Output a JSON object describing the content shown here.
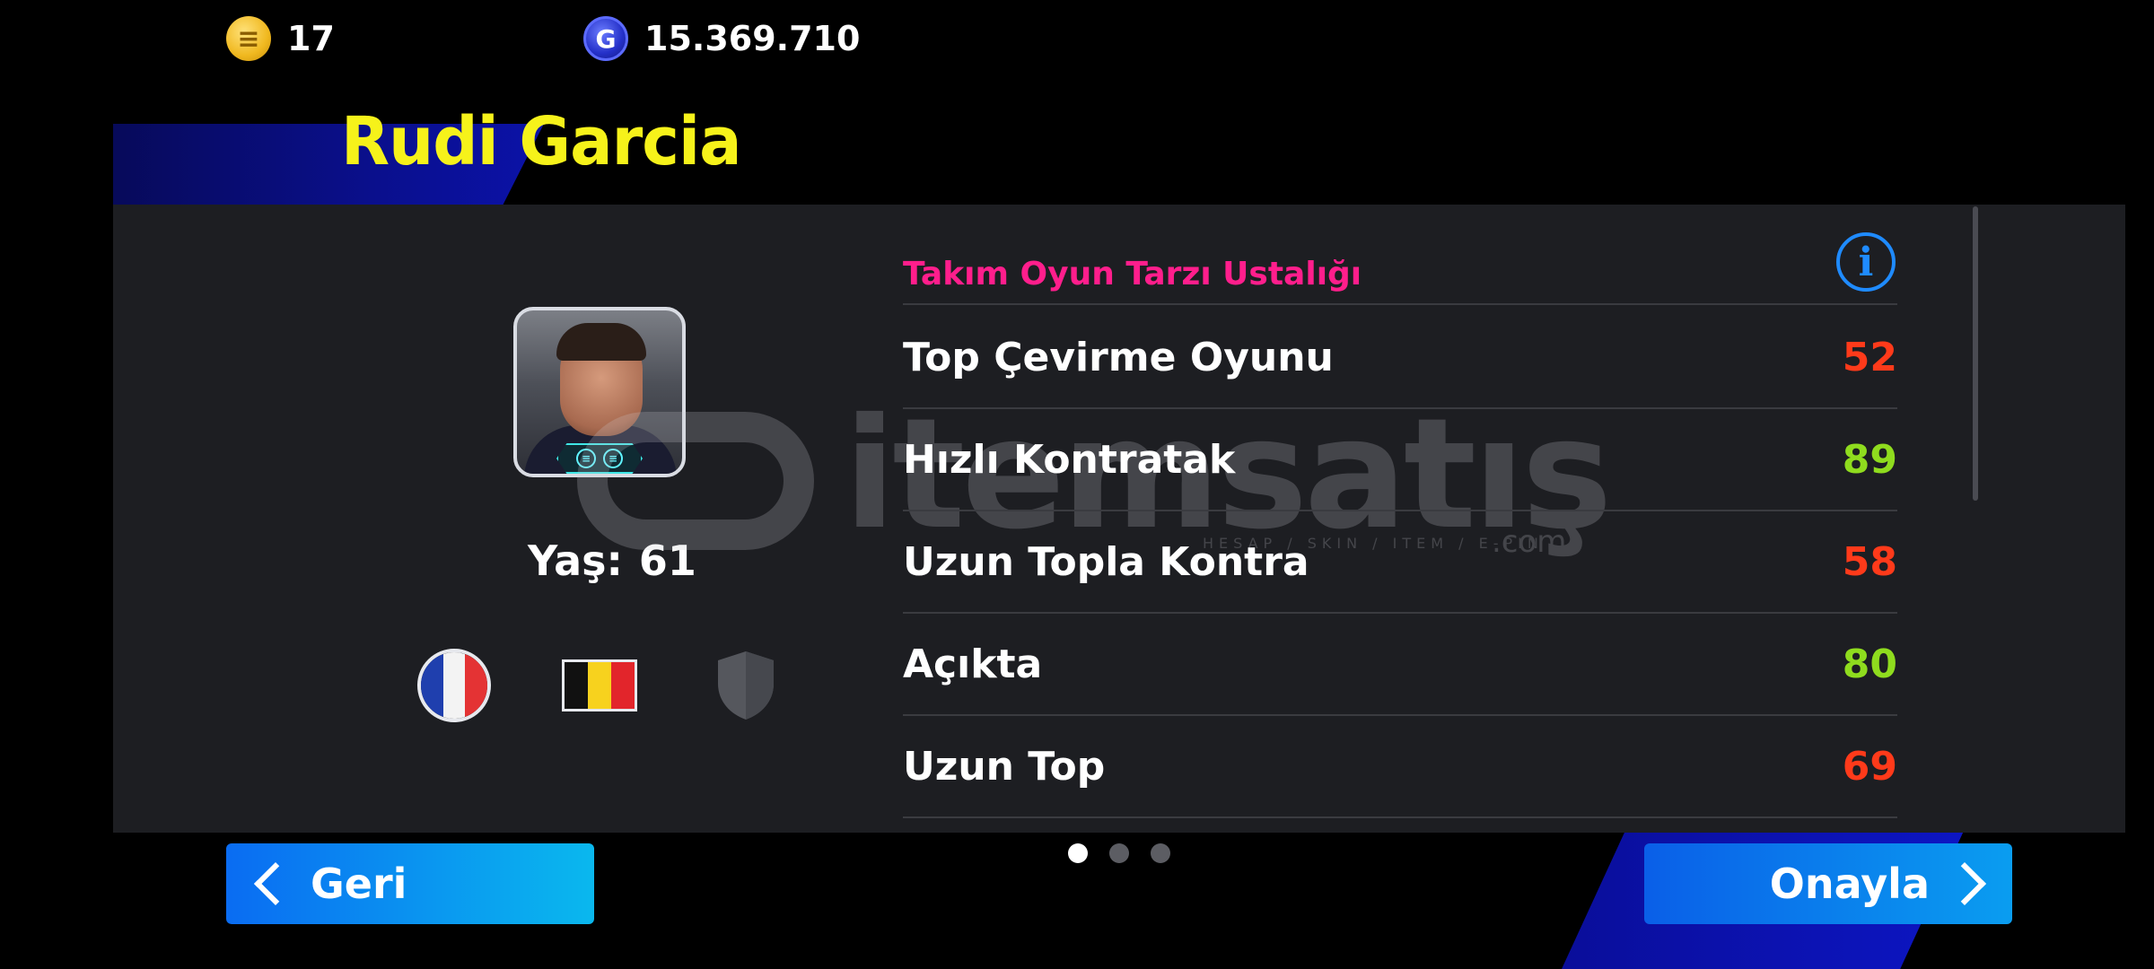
{
  "currency": {
    "coins": "17",
    "gp": "15.369.710",
    "coin_icon_glyph": "≡",
    "gp_icon_glyph": "G"
  },
  "manager": {
    "name": "Rudi Garcia",
    "age_label": "Yaş:",
    "age_value": "61"
  },
  "playstyle": {
    "heading": "Takım Oyun Tarzı Ustalığı",
    "info_glyph": "i",
    "rows": [
      {
        "label": "Top Çevirme Oyunu",
        "value": "52",
        "level": "low"
      },
      {
        "label": "Hızlı Kontratak",
        "value": "89",
        "level": "high"
      },
      {
        "label": "Uzun Topla Kontra",
        "value": "58",
        "level": "low"
      },
      {
        "label": "Açıkta",
        "value": "80",
        "level": "high"
      },
      {
        "label": "Uzun Top",
        "value": "69",
        "level": "low"
      }
    ]
  },
  "colors": {
    "title": "#f6f21a",
    "heading": "#ff1e8c",
    "value_low": "#ff3a1a",
    "value_high": "#8fdc1e",
    "button": "#0a8cf0"
  },
  "watermark": {
    "brand": "itemsatış",
    "tagline": "HESAP / SKIN / ITEM / E-PIN",
    "domain": ".com"
  },
  "pagination": {
    "pages": 3,
    "current": 1
  },
  "buttons": {
    "back": "Geri",
    "confirm": "Onayla"
  },
  "icons": {
    "coin": "efootball-coin-icon",
    "gp": "gp-icon",
    "info": "info-icon",
    "nationality": "france-flag-icon",
    "secondary_nation": "belgium-flag-icon",
    "club": "club-shield-icon",
    "back": "chevron-left-icon",
    "confirm": "chevron-right-icon"
  }
}
